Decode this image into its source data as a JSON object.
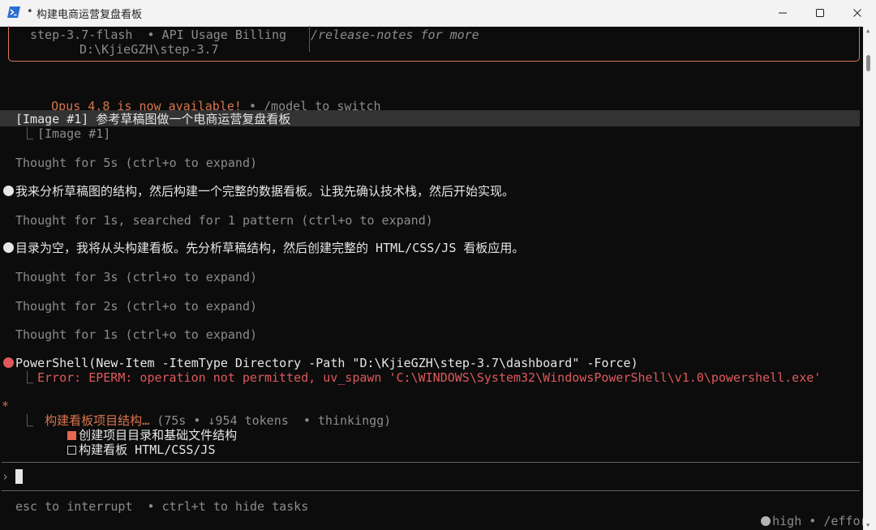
{
  "window": {
    "title": "构建电商运营复盘看板",
    "title_prefix": "•",
    "min_glyph": "—",
    "max_glyph": "☐",
    "close_glyph": "✕"
  },
  "welcome": {
    "model_line": "step-3.7-flash  • API Usage Billing",
    "path_line": "D:\\KjieGZH\\step-3.7",
    "notes_line": "/release-notes for more"
  },
  "update": {
    "available": "Opus 4.8 is now available!",
    "hint": " • /model to switch"
  },
  "transcript": {
    "user_prompt": "[Image #1] 参考草稿图做一个电商运营复盘看板",
    "image_ref": "[Image #1]",
    "thought_1": "Thought for 5s (ctrl+o to expand)",
    "msg_1": "我来分析草稿图的结构，然后构建一个完整的数据看板。让我先确认技术栈，然后开始实现。",
    "thought_2": "Thought for 1s, searched for 1 pattern (ctrl+o to expand)",
    "msg_2": "目录为空，我将从头构建看板。先分析草稿结构，然后创建完整的 HTML/CSS/JS 看板应用。",
    "thought_3": "Thought for 3s (ctrl+o to expand)",
    "thought_4": "Thought for 2s (ctrl+o to expand)",
    "thought_5": "Thought for 1s (ctrl+o to expand)",
    "tool_call": "PowerShell(New-Item -ItemType Directory -Path \"D:\\KjieGZH\\step-3.7\\dashboard\" -Force)",
    "tool_error": "Error: EPERM: operation not permitted, uv_spawn 'C:\\WINDOWS\\System32\\WindowsPowerShell\\v1.0\\powershell.exe'",
    "status_star": "*",
    "status_label": "构建看板项目结构…",
    "status_detail": " (75s • ↓954 tokens  • thinkingg)",
    "tasks": [
      {
        "label": "创建项目目录和基础文件结构",
        "done": true
      },
      {
        "label": "构建看板 HTML/CSS/JS",
        "done": false
      }
    ],
    "tree_glyph": "⎿"
  },
  "prompt": {
    "chevron": "›"
  },
  "footer": {
    "left": "esc to interrupt  • ctrl+t to hide tasks",
    "effort_level": "high",
    "effort_cmd": " • /effort"
  },
  "colors": {
    "accent": "#d97757",
    "error": "#e0585b",
    "background": "#0c0c0c"
  },
  "icons": [
    "powershell-icon",
    "minimize-icon",
    "maximize-icon",
    "close-icon"
  ]
}
